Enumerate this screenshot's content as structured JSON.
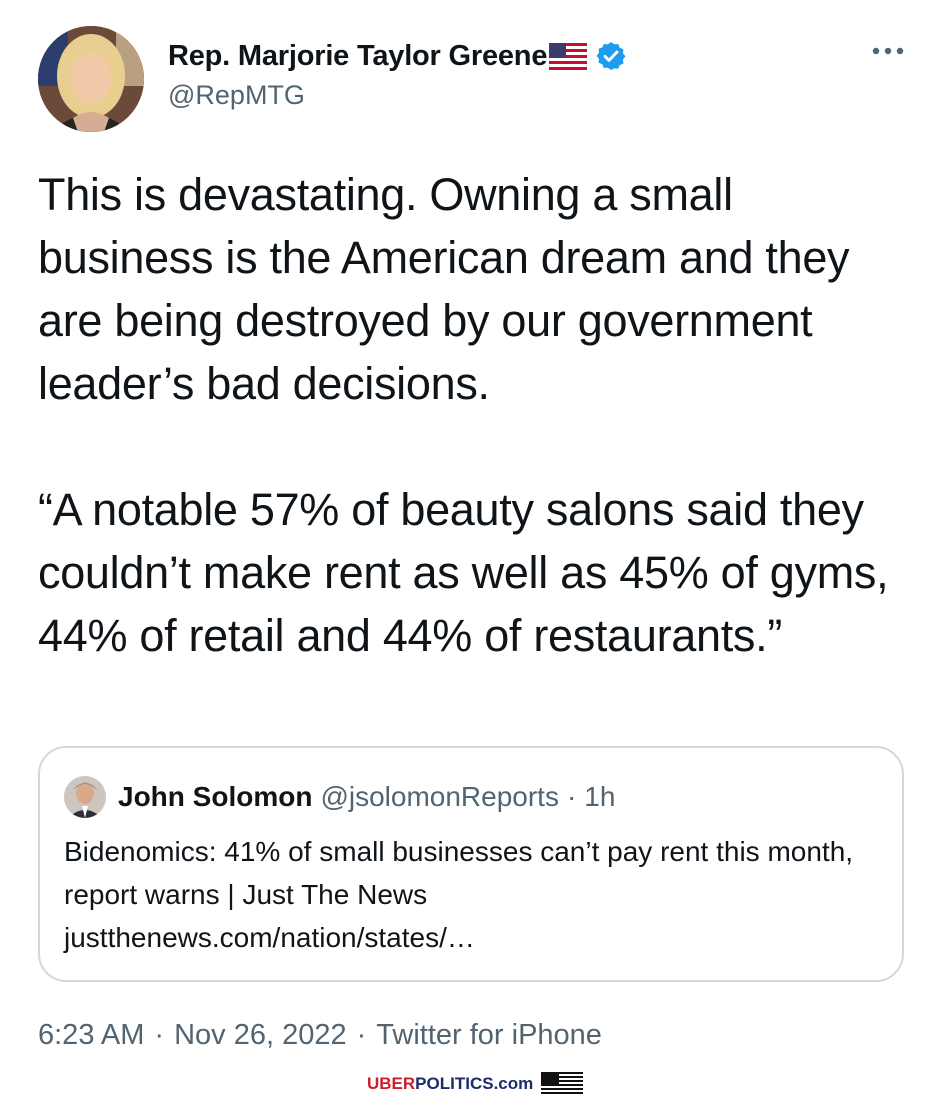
{
  "author": {
    "display_name": "Rep. Marjorie Taylor Greene",
    "handle": "@RepMTG",
    "avatar_icon": "profile-photo",
    "flag_icon": "us-flag-emoji",
    "verified_icon": "verified-badge",
    "verified_color": "#1d9bf0"
  },
  "more_icon": "more-horizontal-icon",
  "tweet_text": "This is devastating. Owning a small business is the American dream and they are being destroyed by our government leader’s bad decisions.\n\n“A notable 57% of beauty salons said they couldn’t make rent as well as 45% of gyms, 44% of retail and 44% of restaurants.”",
  "quoted_tweet": {
    "author_name": "John Solomon",
    "handle": "@jsolomonReports",
    "separator": "·",
    "time": "1h",
    "text": "Bidenomics: 41% of small businesses can’t pay rent this month, report warns | Just The News\njustthenews.com/nation/states/…"
  },
  "meta": {
    "time": "6:23 AM",
    "separator": "·",
    "date": "Nov 26, 2022",
    "source": "Twitter for iPhone"
  },
  "watermark": {
    "part1": "UBER",
    "part2": "POLITICS.com",
    "colors": {
      "red": "#cc1f2e",
      "blue": "#1a2c6b"
    }
  },
  "colors": {
    "text": "#0f1419",
    "secondary": "#536471",
    "border": "#cfd9de"
  }
}
